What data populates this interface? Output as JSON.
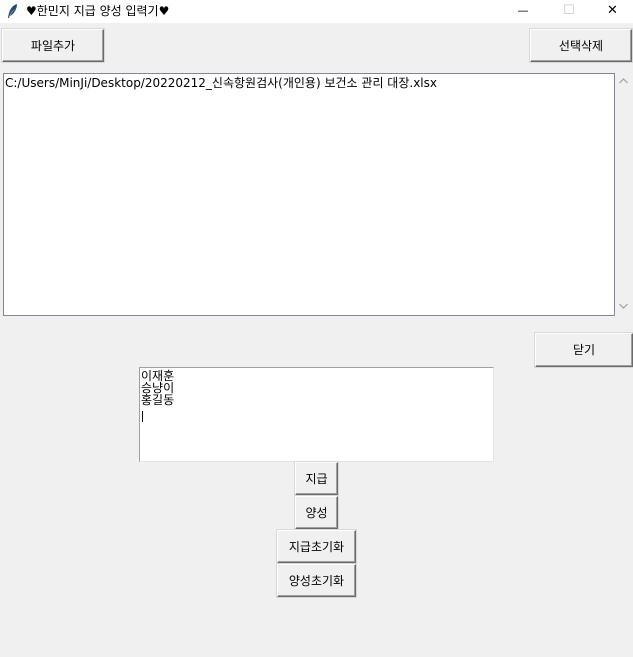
{
  "window": {
    "title": "♥한민지 지급 양성 입력기♥",
    "icon": "feather-icon",
    "controls": {
      "minimize": "—",
      "maximize": "☐",
      "close": "✕"
    }
  },
  "toolbar": {
    "add_file_label": "파일추가",
    "delete_selected_label": "선택삭제"
  },
  "file_list": {
    "items": [
      "C:/Users/MinJi/Desktop/20220212_신속항원검사(개인용) 보건소 관리 대장.xlsx"
    ]
  },
  "close_button_label": "닫기",
  "names_text": {
    "lines": [
      "이재훈",
      "승냥이",
      "홍길동"
    ]
  },
  "actions": {
    "pay_label": "지급",
    "positive_label": "양성",
    "reset_pay_label": "지급초기화",
    "reset_positive_label": "양성초기화"
  }
}
